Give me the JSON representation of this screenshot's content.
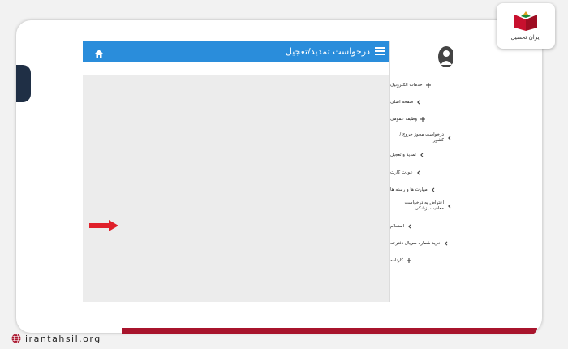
{
  "page": {
    "site_url": "irantahsil.org",
    "logo_text": "ایران تحصیل",
    "accent_color": "#a8142c"
  },
  "app": {
    "title": "درخواست تمدید/تعجیل",
    "header_color": "#2a8ddb",
    "icons": {
      "home": "home-icon",
      "menu": "hamburger-icon",
      "user": "user-avatar-icon"
    }
  },
  "sidebar": {
    "items": [
      {
        "label": "خدمات الکترونیک",
        "icon": "plus"
      },
      {
        "label": "صفحه اصلی",
        "icon": "chevron"
      },
      {
        "label": "وظیفه عمومی",
        "icon": "plus"
      },
      {
        "label": "درخواست مجوز خروج / کشور",
        "icon": "chevron"
      },
      {
        "label": "تمدید و تعجیل",
        "icon": "chevron"
      },
      {
        "label": "عودت کارت",
        "icon": "chevron"
      },
      {
        "label": "مهارت ها و رسته ها",
        "icon": "chevron"
      },
      {
        "label": "اعتراض به درخواست معافیت پزشکی",
        "icon": "chevron"
      },
      {
        "label": "استعلام",
        "icon": "chevron"
      },
      {
        "label": "خرید شماره سریال دفترچه",
        "icon": "chevron"
      },
      {
        "label": "کارنامه",
        "icon": "plus"
      }
    ]
  }
}
